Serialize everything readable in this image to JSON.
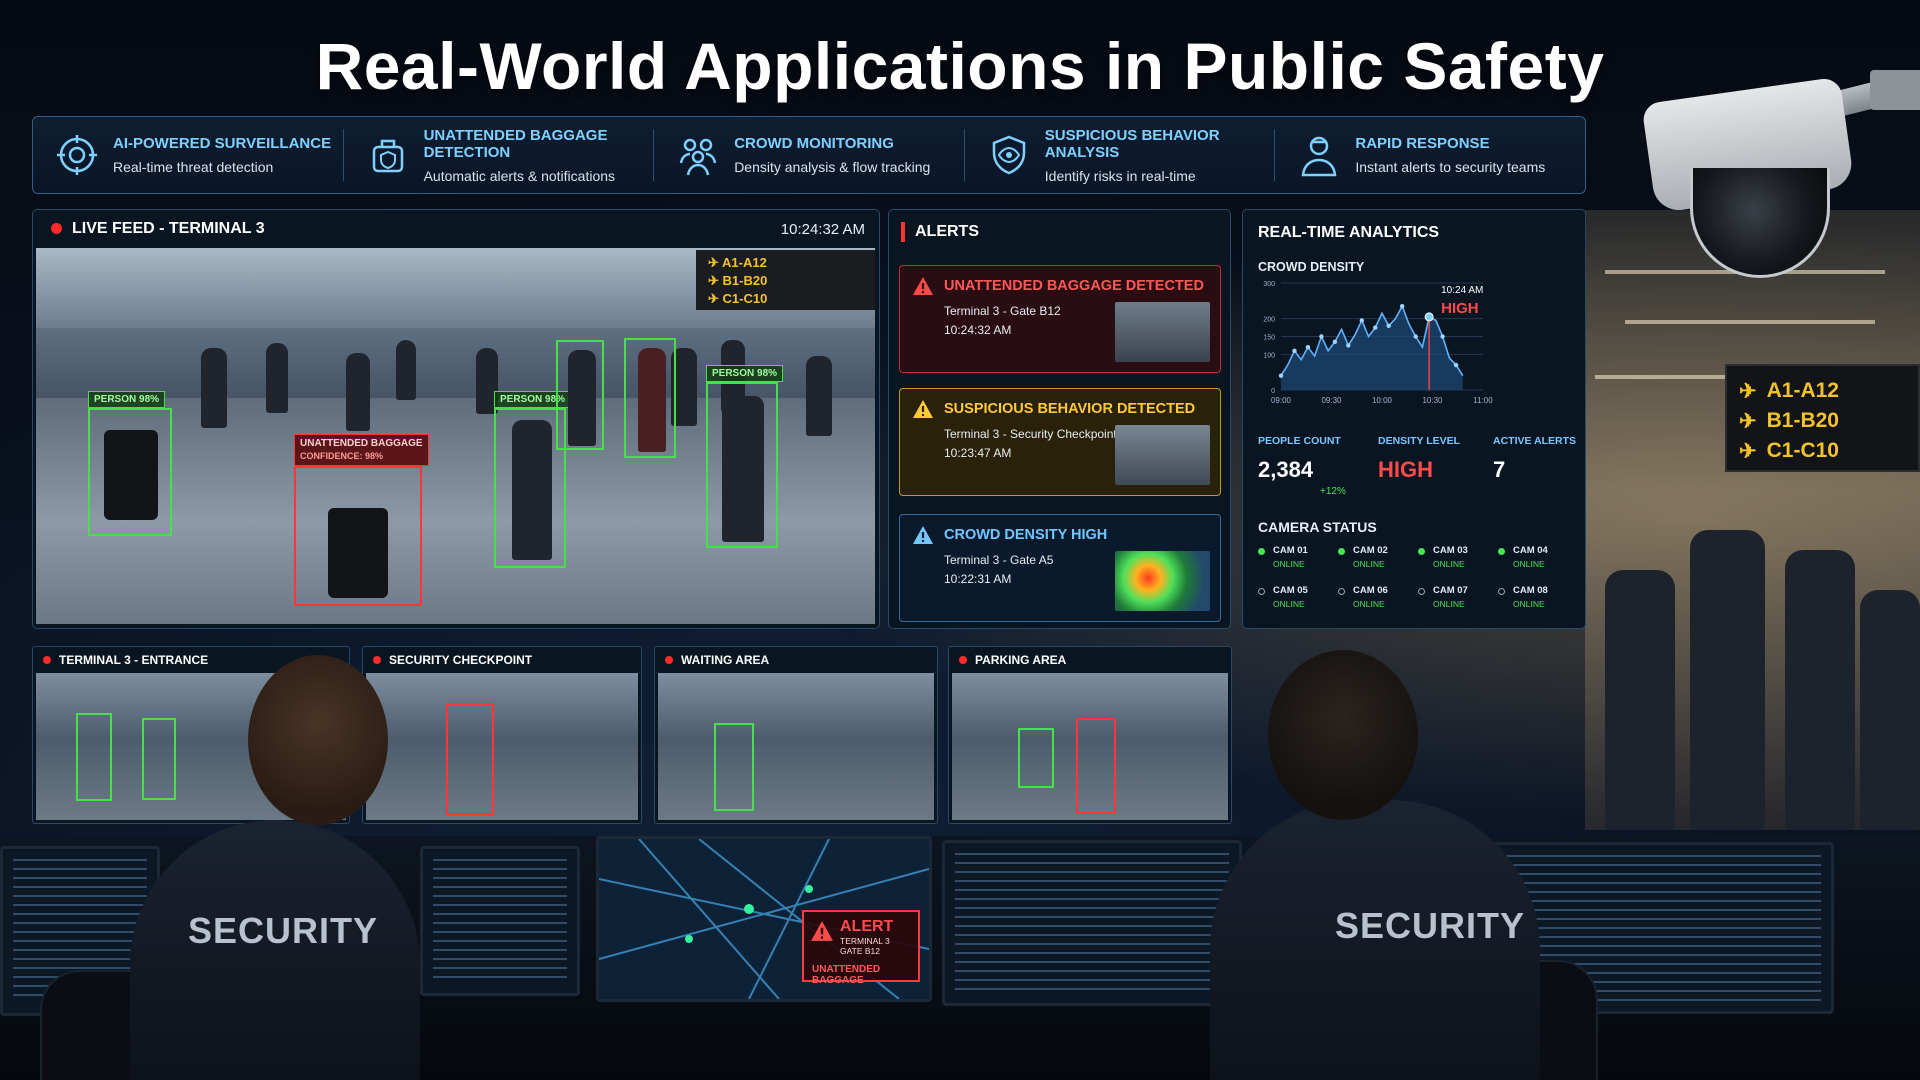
{
  "page": {
    "title": "Real-World Applications in Public Safety"
  },
  "features": [
    {
      "icon": "ai-target-icon",
      "title": "AI-Powered Surveillance",
      "desc": "Real-time threat detection"
    },
    {
      "icon": "baggage-shield-icon",
      "title": "Unattended Baggage Detection",
      "desc": "Automatic alerts & notifications"
    },
    {
      "icon": "crowd-icon",
      "title": "Crowd Monitoring",
      "desc": "Density analysis & flow tracking"
    },
    {
      "icon": "shield-eye-icon",
      "title": "Suspicious Behavior Analysis",
      "desc": "Identify risks in real-time"
    },
    {
      "icon": "responder-icon",
      "title": "Rapid Response",
      "desc": "Instant alerts to security teams"
    }
  ],
  "live_feed": {
    "title": "LIVE FEED - TERMINAL 3",
    "time": "10:24:32 AM",
    "gates": [
      "A1-A12",
      "B1-B20",
      "C1-C10"
    ],
    "detections": {
      "person_label": "PERSON 98%",
      "baggage_label": "UNATTENDED BAGGAGE",
      "baggage_confidence": "CONFIDENCE: 98%"
    }
  },
  "alerts": {
    "title": "ALERTS",
    "items": [
      {
        "title": "Unattended Baggage Detected",
        "location": "Terminal 3 - Gate B12",
        "time": "10:24:32 AM",
        "severity": "critical"
      },
      {
        "title": "Suspicious Behavior Detected",
        "location": "Terminal 3 - Security Checkpoint",
        "time": "10:23:47 AM",
        "severity": "warning"
      },
      {
        "title": "Crowd Density High",
        "location": "Terminal 3 - Gate A5",
        "time": "10:22:31 AM",
        "severity": "info"
      }
    ]
  },
  "analytics": {
    "title": "REAL-TIME ANALYTICS",
    "crowd_density_label": "CROWD DENSITY",
    "peak_time": "10:24 AM",
    "peak_level": "HIGH",
    "people_count_label": "PEOPLE COUNT",
    "people_count": "2,384",
    "people_change": "+12%",
    "density_level_label": "DENSITY LEVEL",
    "density_level": "HIGH",
    "active_alerts_label": "ACTIVE ALERTS",
    "active_alerts": "7",
    "camera_status_label": "CAMERA STATUS",
    "cameras": [
      {
        "name": "CAM 01",
        "status": "ONLINE",
        "state": "on"
      },
      {
        "name": "CAM 02",
        "status": "ONLINE",
        "state": "on"
      },
      {
        "name": "CAM 03",
        "status": "ONLINE",
        "state": "on"
      },
      {
        "name": "CAM 04",
        "status": "ONLINE",
        "state": "on"
      },
      {
        "name": "CAM 05",
        "status": "ONLINE",
        "state": "off"
      },
      {
        "name": "CAM 06",
        "status": "ONLINE",
        "state": "off"
      },
      {
        "name": "CAM 07",
        "status": "ONLINE",
        "state": "off"
      },
      {
        "name": "CAM 08",
        "status": "ONLINE",
        "state": "off"
      }
    ]
  },
  "chart_data": {
    "type": "area",
    "title": "CROWD DENSITY",
    "x_ticks": [
      "09:00",
      "09:30",
      "10:00",
      "10:30",
      "11:00"
    ],
    "y_ticks": [
      "0",
      "100",
      "150",
      "200",
      "300"
    ],
    "xlim": [
      0,
      120
    ],
    "ylim": [
      0,
      300
    ],
    "series": [
      {
        "x": [
          0,
          4,
          8,
          12,
          16,
          20,
          24,
          28,
          32,
          36,
          40,
          44,
          48,
          52,
          56,
          60,
          64,
          68,
          72,
          76,
          80,
          84,
          88,
          92,
          96,
          100,
          104,
          108
        ],
        "values": [
          40,
          70,
          110,
          85,
          120,
          95,
          150,
          110,
          135,
          170,
          125,
          155,
          195,
          150,
          175,
          215,
          180,
          200,
          235,
          185,
          150,
          120,
          205,
          195,
          150,
          90,
          70,
          40
        ]
      }
    ],
    "colors": {
      "line": "#5fb2ff",
      "fill": "#1e4a78",
      "grid": "#24384f"
    }
  },
  "small_feeds": [
    {
      "title": "TERMINAL 3 - ENTRANCE"
    },
    {
      "title": "SECURITY CHECKPOINT"
    },
    {
      "title": "WAITING AREA"
    },
    {
      "title": "PARKING AREA"
    }
  ],
  "desk": {
    "map_alert_title": "ALERT",
    "map_alert_location": "TERMINAL 3",
    "map_alert_gate": "GATE B12",
    "map_alert_type": "UNATTENDED BAGGAGE",
    "officer_label": "SECURITY"
  },
  "gate_sign": [
    "A1-A12",
    "B1-B20",
    "C1-C10"
  ],
  "colors": {
    "accent": "#7fd0ff",
    "critical": "#ff4a4a",
    "warning": "#ffc93a",
    "online": "#4fe05a",
    "detection_green": "#47e04a",
    "detection_red": "#ff3636"
  }
}
